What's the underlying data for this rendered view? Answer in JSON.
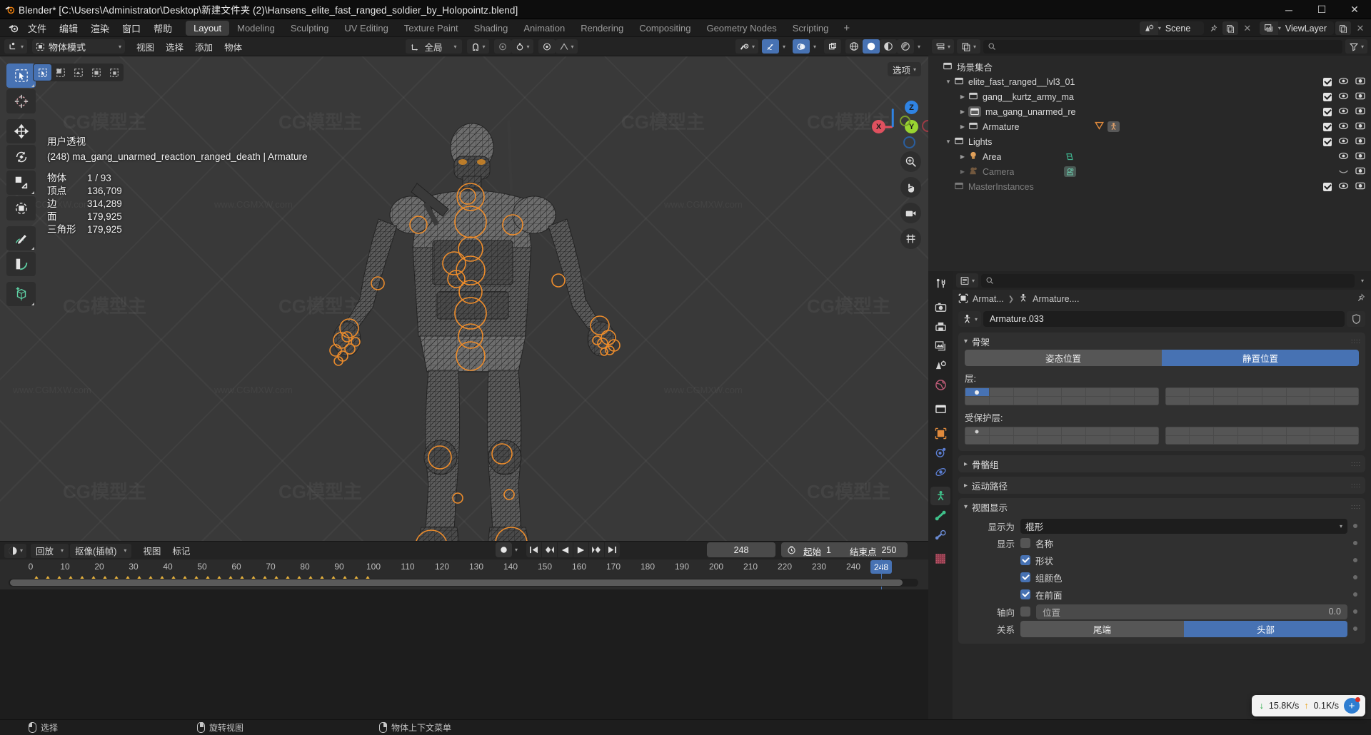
{
  "window": {
    "title": "Blender* [C:\\Users\\Administrator\\Desktop\\新建文件夹 (2)\\Hansens_elite_fast_ranged_soldier_by_Holopointz.blend]",
    "minimize": "─",
    "maximize": "☐",
    "close": "✕"
  },
  "topbar": {
    "menus": [
      "文件",
      "编辑",
      "渲染",
      "窗口",
      "帮助"
    ],
    "workspaces": [
      {
        "label": "Layout",
        "active": true
      },
      {
        "label": "Modeling",
        "active": false
      },
      {
        "label": "Sculpting",
        "active": false
      },
      {
        "label": "UV Editing",
        "active": false
      },
      {
        "label": "Texture Paint",
        "active": false
      },
      {
        "label": "Shading",
        "active": false
      },
      {
        "label": "Animation",
        "active": false
      },
      {
        "label": "Rendering",
        "active": false
      },
      {
        "label": "Compositing",
        "active": false
      },
      {
        "label": "Geometry Nodes",
        "active": false
      },
      {
        "label": "Scripting",
        "active": false
      }
    ],
    "add_workspace": "+",
    "scene_name": "Scene",
    "viewlayer_name": "ViewLayer"
  },
  "viewport_header": {
    "mode": "物体模式",
    "menus": [
      "视图",
      "选择",
      "添加",
      "物体"
    ],
    "orientation": "全局",
    "options_label": "选项"
  },
  "viewport": {
    "view_name": "用户透视",
    "object_line": "(248) ma_gang_unarmed_reaction_ranged_death | Armature",
    "stats": [
      {
        "key": "物体",
        "value": "1 / 93"
      },
      {
        "key": "顶点",
        "value": "136,709"
      },
      {
        "key": "边",
        "value": "314,289"
      },
      {
        "key": "面",
        "value": "179,925"
      },
      {
        "key": "三角形",
        "value": "179,925"
      }
    ],
    "gizmo_axes": [
      "X",
      "Y",
      "Z"
    ],
    "axis_colors": {
      "x": "#e0515f",
      "y": "#99d531",
      "z": "#2f83e3"
    },
    "watermarks": [
      "www.CGMXW.com",
      "CG模型主"
    ]
  },
  "timeline": {
    "editor_menu_label": "回放",
    "keying_label": "抠像(插帧)",
    "menus": [
      "视图",
      "标记"
    ],
    "ticks": [
      "0",
      "10",
      "20",
      "30",
      "40",
      "50",
      "60",
      "70",
      "80",
      "90",
      "100",
      "110",
      "120",
      "130",
      "140",
      "150",
      "160",
      "170",
      "180",
      "190",
      "200",
      "210",
      "220",
      "230",
      "240"
    ],
    "current_frame": "248",
    "start_label": "起始",
    "start_value": "1",
    "end_label": "结束点",
    "end_value": "250"
  },
  "statusbar": {
    "items": [
      {
        "button": "left",
        "label": "选择"
      },
      {
        "button": "middle",
        "label": "旋转视图"
      },
      {
        "button": "right",
        "label": "物体上下文菜单"
      }
    ]
  },
  "outliner": {
    "title": "场景集合",
    "rows": [
      {
        "name": "elite_fast_ranged__lvl3_01",
        "depth": 1,
        "disclosure": "open",
        "icon": "collection-icon",
        "checkbox": true,
        "eye": true,
        "camera": true,
        "dim": false
      },
      {
        "name": "gang__kurtz_army_ma",
        "depth": 2,
        "disclosure": "closed",
        "icon": "collection-icon",
        "checkbox": true,
        "eye": true,
        "camera": true,
        "dim": false
      },
      {
        "name": "ma_gang_unarmed_re",
        "depth": 2,
        "disclosure": "closed",
        "icon": "collection-icon-active",
        "checkbox": true,
        "eye": true,
        "camera": true,
        "dim": false
      },
      {
        "name": "Armature",
        "depth": 2,
        "disclosure": "closed",
        "icon": "collection-icon",
        "checkbox": true,
        "eye": true,
        "camera": true,
        "dim": false,
        "badges": [
          "modifier-icon",
          "armature-icon"
        ]
      },
      {
        "name": "Lights",
        "depth": 1,
        "disclosure": "open",
        "icon": "collection-icon",
        "checkbox": true,
        "eye": true,
        "camera": true,
        "dim": false
      },
      {
        "name": "Area",
        "depth": 2,
        "disclosure": "closed",
        "icon": "light-icon",
        "checkbox": false,
        "eye": true,
        "camera": true,
        "dim": false
      },
      {
        "name": "Camera",
        "depth": 2,
        "disclosure": "closed",
        "icon": "camera-object-icon",
        "checkbox": false,
        "eye": false,
        "camera": true,
        "dim": true
      },
      {
        "name": "MasterInstances",
        "depth": 1,
        "disclosure": "none",
        "icon": "collection-icon",
        "checkbox": true,
        "eye": true,
        "camera": true,
        "dim": true
      }
    ]
  },
  "properties": {
    "breadcrumb": [
      "Armat...",
      "Armature...."
    ],
    "datablock_name": "Armature.033",
    "panels": {
      "skeleton": {
        "title": "骨架",
        "pose_position": "姿态位置",
        "rest_position": "静置位置",
        "rest_active": true,
        "layers_label": "层:",
        "protected_layers_label": "受保护层:"
      },
      "bone_groups": {
        "title": "骨骼组"
      },
      "motion_paths": {
        "title": "运动路径"
      },
      "viewport_display": {
        "title": "视图显示",
        "display_as_label": "显示为",
        "display_as_value": "棍形",
        "show_label": "显示",
        "checkboxes": [
          {
            "label": "名称",
            "checked": false
          },
          {
            "label": "形状",
            "checked": true
          },
          {
            "label": "组颜色",
            "checked": true
          },
          {
            "label": "在前面",
            "checked": true
          }
        ],
        "axes_label": "轴向",
        "axes_checked": false,
        "position_label": "位置",
        "position_value": "0.0",
        "relations_label": "关系",
        "relations_tail": "尾端",
        "relations_head": "头部",
        "relations_head_active": true
      }
    }
  },
  "download_toast": {
    "down_speed": "15.8K/s",
    "up_speed": "0.1K/s",
    "down_arrow": "↓",
    "up_arrow": "↑"
  },
  "colors": {
    "accent_blue": "#4772b3",
    "bone_orange": "#ec8c2c",
    "viewport_bg": "#393939",
    "panel_bg": "#282828",
    "header_bg": "#232323"
  }
}
